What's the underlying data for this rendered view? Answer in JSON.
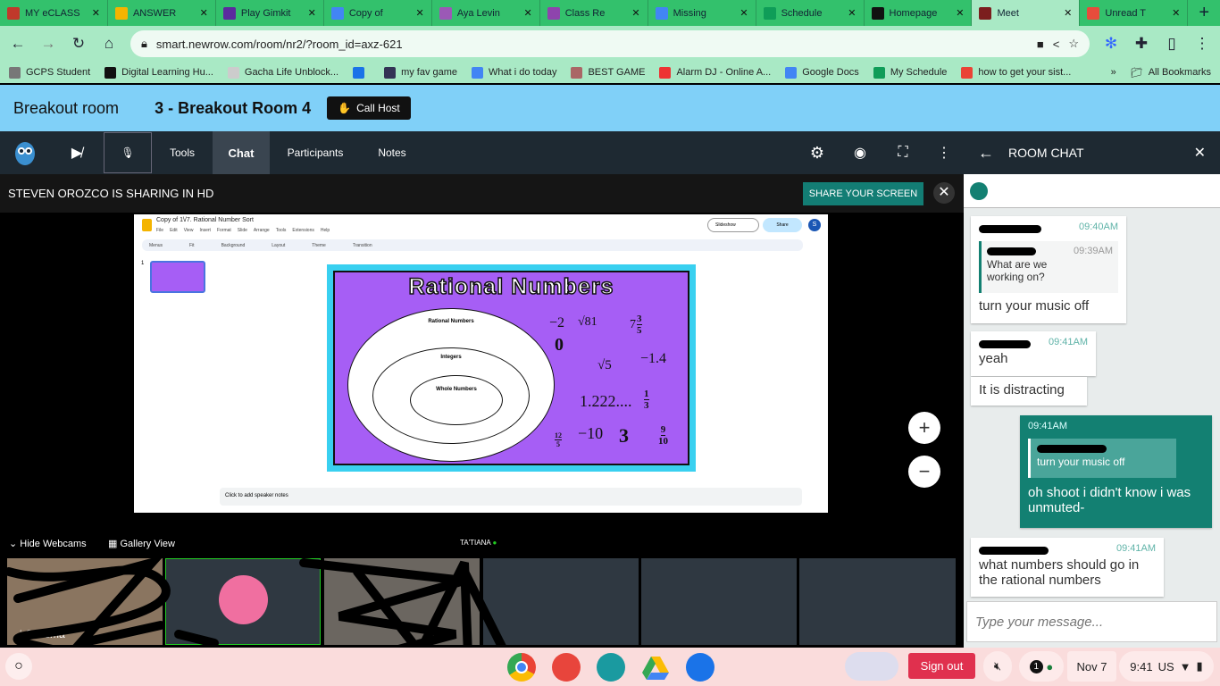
{
  "browser": {
    "tabs": [
      {
        "label": "MY eCLASS",
        "color": "#c0392b"
      },
      {
        "label": "ANSWER",
        "color": "#f4b400"
      },
      {
        "label": "Play Gimkit",
        "color": "#5b2a9e"
      },
      {
        "label": "Copy of",
        "color": "#4285f4"
      },
      {
        "label": "Aya Levin",
        "color": "#9b59b6"
      },
      {
        "label": "Class Re",
        "color": "#8e44ad"
      },
      {
        "label": "Missing",
        "color": "#4285f4"
      },
      {
        "label": "Schedule",
        "color": "#0f9d58"
      },
      {
        "label": "Homepage",
        "color": "#111111"
      },
      {
        "label": "Meet",
        "color": "#7b1e1e",
        "active": true
      },
      {
        "label": "Unread T",
        "color": "#e74c3c"
      }
    ],
    "url": "smart.newrow.com/room/nr2/?room_id=axz-621",
    "bookmarks": [
      "GCPS Student",
      "Digital Learning Hu...",
      "Gacha Life Unblock...",
      "",
      "my fav game",
      "What i do today",
      "BEST GAME",
      "Alarm DJ - Online A...",
      "Google Docs",
      "My Schedule",
      "how to get your sist..."
    ],
    "all_bookmarks": "All Bookmarks"
  },
  "header": {
    "room_label": "Breakout room",
    "room_name": "3 - Breakout Room 4",
    "call_host": "Call Host"
  },
  "toolbar": {
    "tools": "Tools",
    "chat": "Chat",
    "participants": "Participants",
    "notes": "Notes"
  },
  "share": {
    "status": "STEVEN OROZCO IS SHARING IN HD",
    "button": "SHARE YOUR SCREEN"
  },
  "slides": {
    "title": "Copy of 1\\/7. Rational Number Sort",
    "menu": [
      "File",
      "Edit",
      "View",
      "Insert",
      "Format",
      "Slide",
      "Arrange",
      "Tools",
      "Extensions",
      "Help"
    ],
    "toolbar": [
      "Menus",
      "Fit",
      "Background",
      "Layout",
      "Theme",
      "Transition"
    ],
    "slideshow": "Slideshow",
    "share": "Share",
    "avatar": "S",
    "slide_number": "1",
    "slide_title": "Rational Numbers",
    "sets": [
      "Rational Numbers",
      "Integers",
      "Whole Numbers"
    ],
    "numbers": [
      "−2",
      "√81",
      "0",
      "√5",
      "−1.4",
      "1.222....",
      "−10",
      "3"
    ],
    "fractions": [
      {
        "whole": "7",
        "num": "3",
        "den": "5"
      },
      {
        "num": "1",
        "den": "3"
      },
      {
        "num": "12",
        "den": "5"
      },
      {
        "num": "9",
        "den": "10"
      }
    ],
    "speaker_notes": "Click to add speaker notes"
  },
  "webcams": {
    "hide": "Hide Webcams",
    "gallery": "Gallery View",
    "speaker": "TA'TIANA",
    "tile1_name": "i Chrisma"
  },
  "chat": {
    "title": "ROOM CHAT",
    "messages": [
      {
        "time": "09:40AM",
        "quote_time": "09:39AM",
        "quote": "What are we working on?",
        "text": "turn your music off"
      },
      {
        "time": "09:41AM",
        "text": "yeah",
        "text2": "It is distracting"
      },
      {
        "time": "09:41AM",
        "quote": "turn your music off",
        "text": "oh shoot i didn't know i was unmuted-"
      },
      {
        "time": "09:41AM",
        "text": "what numbers should go in the rational numbers"
      }
    ],
    "placeholder": "Type your message..."
  },
  "shelf": {
    "sign_out": "Sign out",
    "notifications": "1",
    "date": "Nov 7",
    "time": "9:41",
    "locale": "US"
  },
  "colors": {
    "accent": "#137d74",
    "tabbar": "#33c16c",
    "header": "#80d0f8",
    "slide_bg": "#a65ef5",
    "sign_out": "#e0304e"
  }
}
